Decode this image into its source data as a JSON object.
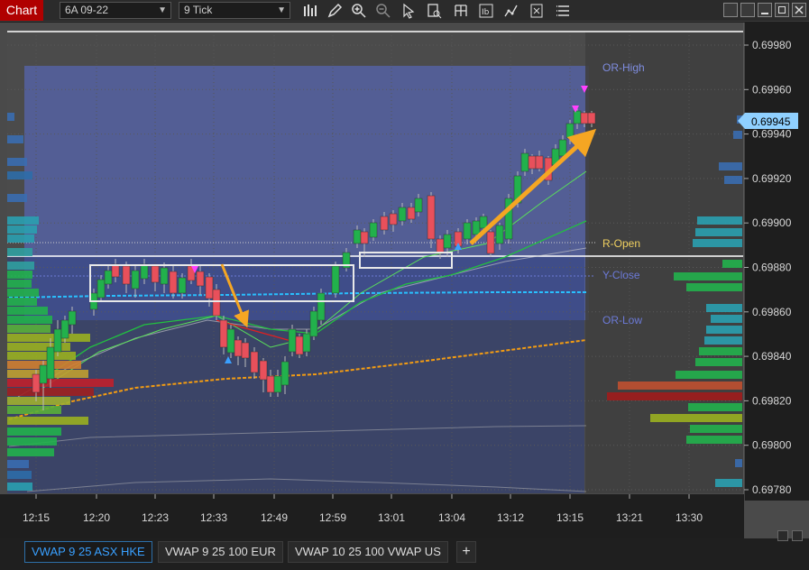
{
  "window": {
    "title": "Chart",
    "instrument": "6A 09-22",
    "interval": "9 Tick"
  },
  "toolbar_icons": [
    "bar-chart-icon",
    "pencil-icon",
    "zoom-in-icon",
    "zoom-out-icon",
    "pointer-icon",
    "data-box-icon",
    "properties-icon",
    "indicators-icon",
    "strategy-icon",
    "templates-icon",
    "menu-icon"
  ],
  "price_axis": {
    "labels": [
      "0.69980",
      "0.69960",
      "0.69940",
      "0.69920",
      "0.69900",
      "0.69880",
      "0.69860",
      "0.69840",
      "0.69820",
      "0.69800",
      "0.69780"
    ],
    "current_price": "0.69945",
    "current_color": "#8fd0ff"
  },
  "time_axis": {
    "labels": [
      "12:15",
      "12:20",
      "12:23",
      "12:33",
      "12:49",
      "12:59",
      "13:01",
      "13:04",
      "13:12",
      "13:15",
      "13:21",
      "13:30"
    ]
  },
  "levels": {
    "or_high": "OR-High",
    "r_open": "R-Open",
    "y_close": "Y-Close",
    "or_low": "OR-Low"
  },
  "colors": {
    "up_candle": "#22b14c",
    "down_candle": "#e8505b",
    "vwap_orange": "#f39c12",
    "range_fill": "#4b5fb0",
    "arrow_orange": "#f5a623"
  },
  "tabs": [
    {
      "label": "VWAP 9 25 ASX HKE",
      "active": true
    },
    {
      "label": "VWAP 9 25 100 EUR",
      "active": false
    },
    {
      "label": "VWAP 10 25 100 VWAP US",
      "active": false
    }
  ],
  "add_tab_label": "+"
}
